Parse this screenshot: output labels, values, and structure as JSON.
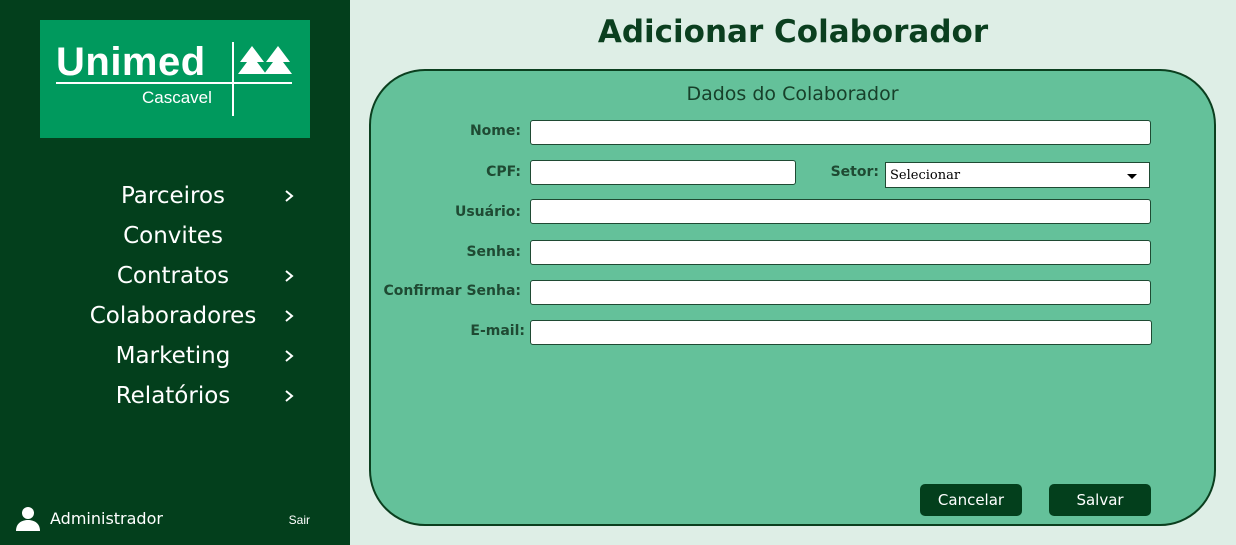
{
  "brand": {
    "name": "Unimed",
    "city": "Cascavel",
    "green": "#00995d",
    "dark_green": "#033f1c"
  },
  "sidebar": {
    "items": [
      {
        "label": "Parceiros",
        "has_submenu": true
      },
      {
        "label": "Convites",
        "has_submenu": false
      },
      {
        "label": "Contratos",
        "has_submenu": true
      },
      {
        "label": "Colaboradores",
        "has_submenu": true
      },
      {
        "label": "Marketing",
        "has_submenu": true
      },
      {
        "label": "Relatórios",
        "has_submenu": true
      }
    ],
    "user": {
      "name": "Administrador",
      "icon": "user-icon"
    },
    "logout_label": "Sair"
  },
  "page": {
    "title": "Adicionar Colaborador"
  },
  "form": {
    "title": "Dados do Colaborador",
    "fields": {
      "nome": {
        "label": "Nome:",
        "value": ""
      },
      "cpf": {
        "label": "CPF:",
        "value": ""
      },
      "setor": {
        "label": "Setor:",
        "selected": "Selecionar"
      },
      "usuario": {
        "label": "Usuário:",
        "value": ""
      },
      "senha": {
        "label": "Senha:",
        "value": ""
      },
      "confirmar_senha": {
        "label": "Confirmar Senha:",
        "value": ""
      },
      "email": {
        "label": "E-mail:",
        "value": ""
      }
    },
    "cancel_label": "Cancelar",
    "save_label": "Salvar"
  }
}
